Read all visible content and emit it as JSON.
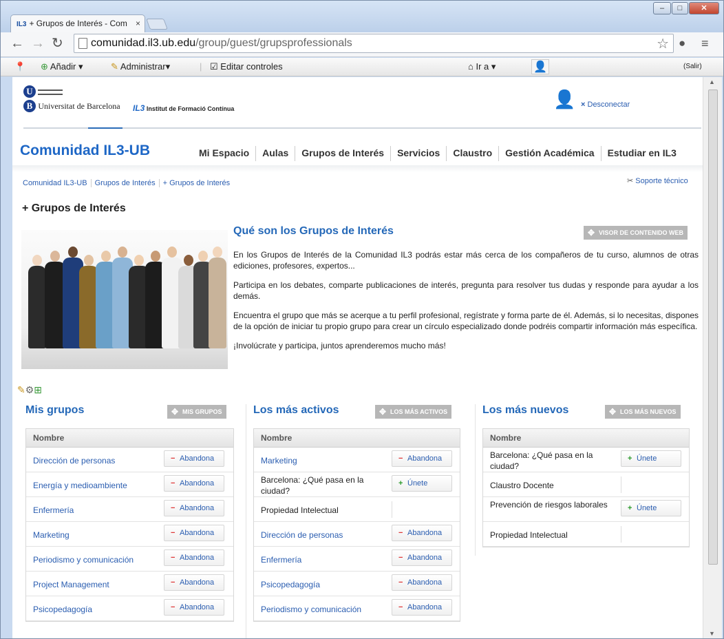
{
  "browser": {
    "tab_title": "+ Grupos de Interés - Com",
    "tab_favicon": "IL3",
    "url_host": "comunidad.il3.ub.edu",
    "url_path": "/group/guest/grupsprofessionals"
  },
  "dockbar": {
    "add_label": "Añadir",
    "manage_label": "Administrar",
    "edit_controls_label": "Editar controles",
    "goto_label": "Ir a",
    "exit_label": "(Salir)"
  },
  "header": {
    "university_name": "Universitat de Barcelona",
    "institute_abbr": "IL3",
    "institute_name": "Institut de Formació Contínua",
    "disconnect_label": "Desconectar"
  },
  "site": {
    "brand": "Comunidad IL3-UB",
    "nav": [
      "Mi Espacio",
      "Aulas",
      "Grupos de Interés",
      "Servicios",
      "Claustro",
      "Gestión Académica",
      "Estudiar en IL3"
    ]
  },
  "breadcrumbs": [
    "Comunidad IL3-UB",
    "Grupos de Interés",
    "+ Grupos de Interés"
  ],
  "support_label": "Soporte técnico",
  "page_title": "+ Grupos de Interés",
  "intro": {
    "title": "Qué son los Grupos de Interés",
    "portlet_label": "Visor de contenido web",
    "paragraphs": [
      "En los Grupos de Interés de la Comunidad IL3 podrás estar más cerca de los compañeros de tu curso, alumnos de otras ediciones, profesores, expertos...",
      "Participa en los debates, comparte publicaciones de interés, pregunta para resolver tus dudas y responde para ayudar a los demás.",
      "Encuentra el grupo que más se acerque a tu perfil profesional, regístrate y forma parte de él. Además, si lo necesitas, dispones de la opción de iniciar tu propio grupo para crear un círculo especializado donde podréis compartir información más específica.",
      "¡Involúcrate y participa, juntos aprenderemos mucho más!"
    ]
  },
  "columns": {
    "header_label": "Nombre",
    "leave_label": "Abandona",
    "join_label": "Únete",
    "mis_grupos": {
      "title": "Mis grupos",
      "portlet_label": "Mis grupos",
      "rows": [
        {
          "name": "Dirección de personas",
          "action": "leave"
        },
        {
          "name": "Energía y medioambiente",
          "action": "leave"
        },
        {
          "name": "Enfermería",
          "action": "leave"
        },
        {
          "name": "Marketing",
          "action": "leave"
        },
        {
          "name": "Periodismo y comunicación",
          "action": "leave"
        },
        {
          "name": "Project Management",
          "action": "leave"
        },
        {
          "name": "Psicopedagogía",
          "action": "leave"
        }
      ]
    },
    "mas_activos": {
      "title": "Los más activos",
      "portlet_label": "Los más activos",
      "rows": [
        {
          "name": "Marketing",
          "action": "leave"
        },
        {
          "name": "Barcelona: ¿Qué pasa en la ciudad?",
          "action": "join"
        },
        {
          "name": "Propiedad Intelectual",
          "action": "none"
        },
        {
          "name": "Dirección de personas",
          "action": "leave"
        },
        {
          "name": "Enfermería",
          "action": "leave"
        },
        {
          "name": "Psicopedagogía",
          "action": "leave"
        },
        {
          "name": "Periodismo y comunicación",
          "action": "leave"
        }
      ]
    },
    "mas_nuevos": {
      "title": "Los más nuevos",
      "portlet_label": "Los más nuevos",
      "rows": [
        {
          "name": "Barcelona: ¿Qué pasa en la ciudad?",
          "action": "join"
        },
        {
          "name": "Claustro Docente",
          "action": "none"
        },
        {
          "name": "Prevención de riesgos laborales",
          "action": "join"
        },
        {
          "name": "Propiedad Intelectual",
          "action": "none"
        }
      ]
    }
  }
}
